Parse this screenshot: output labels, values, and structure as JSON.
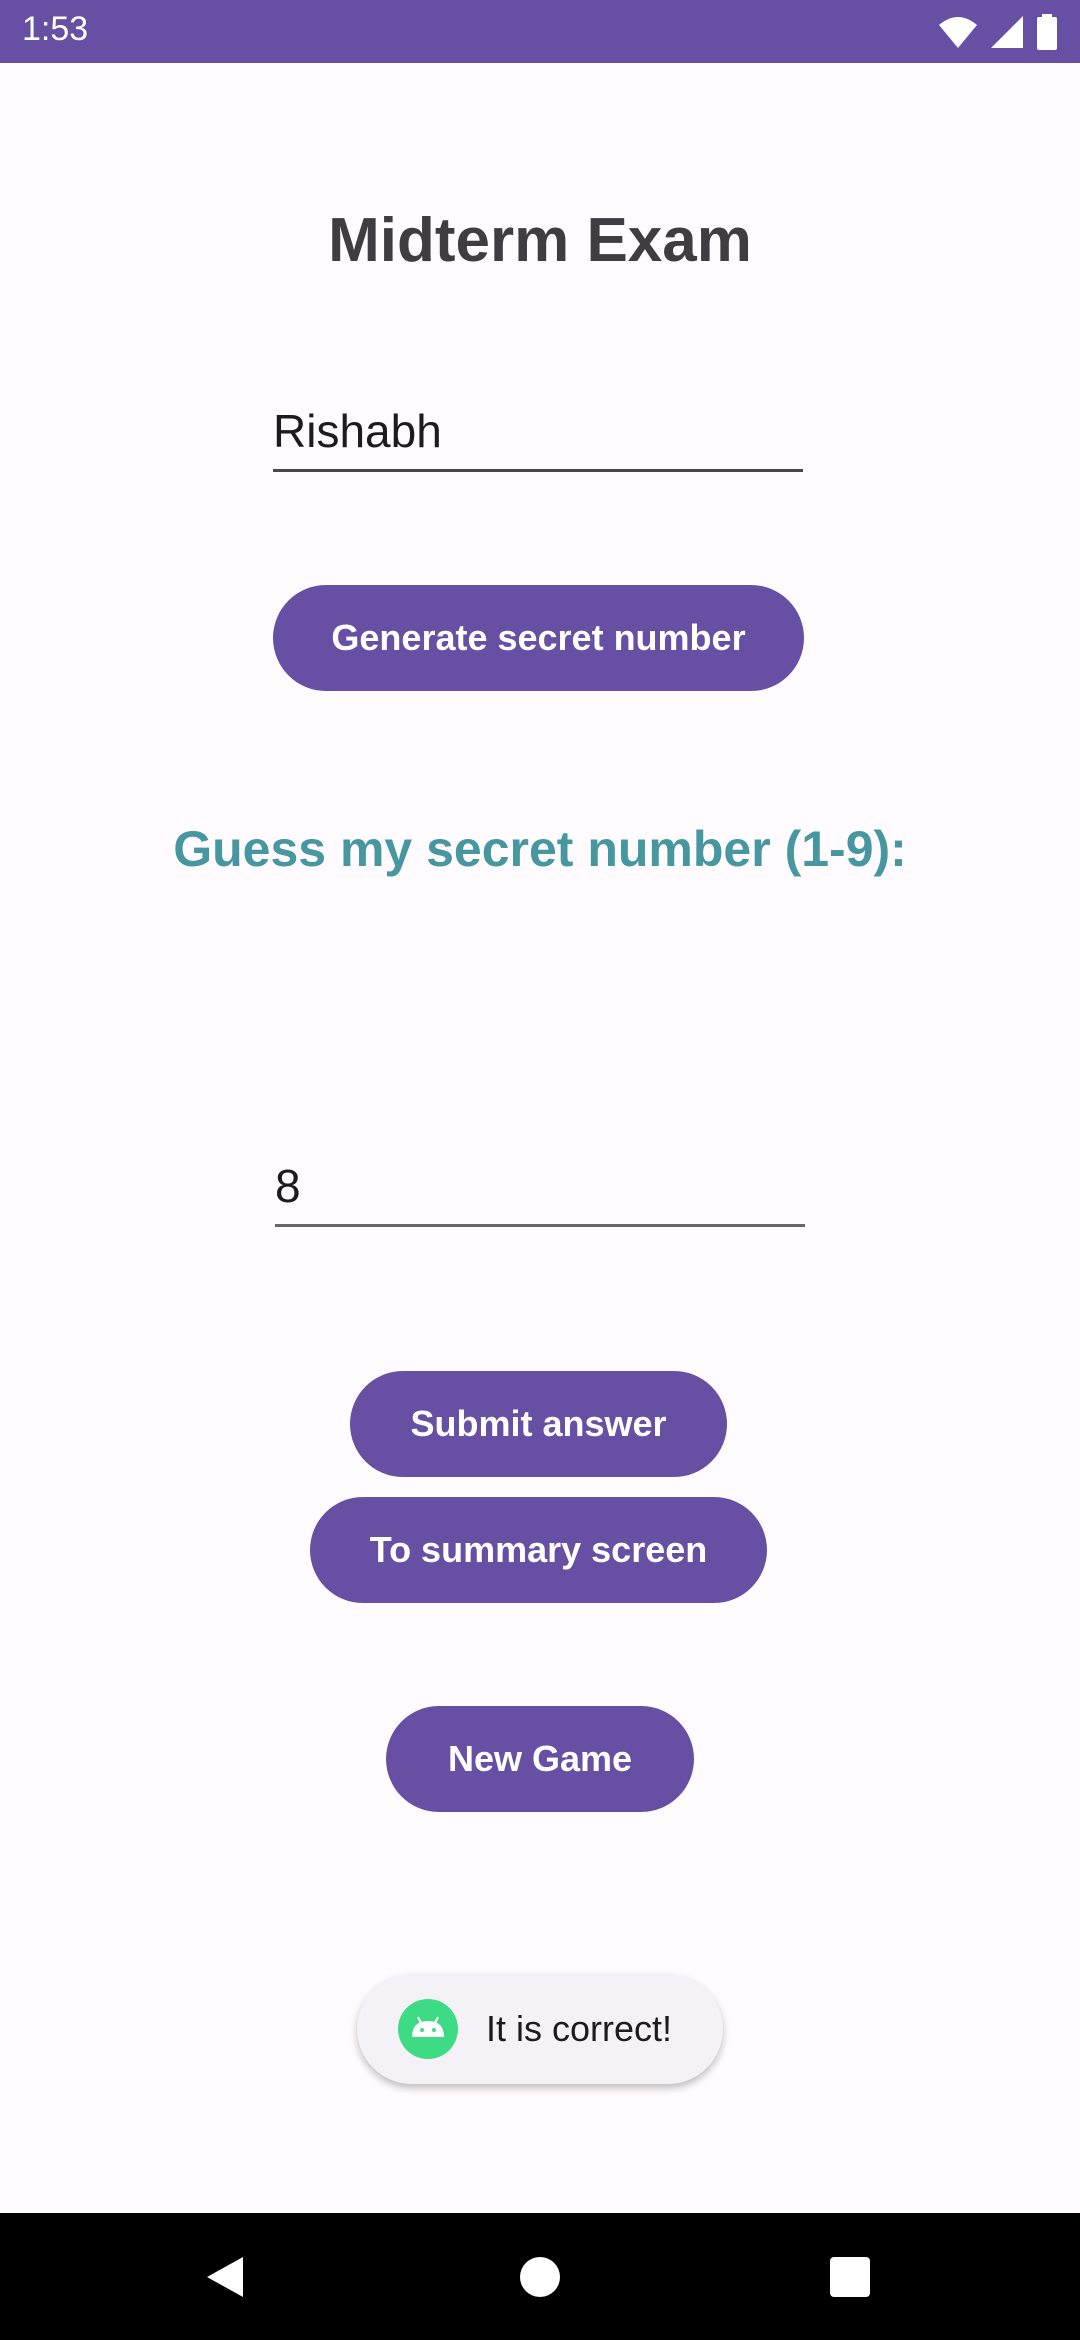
{
  "status_bar": {
    "time": "1:53",
    "icons": [
      "wifi-icon",
      "cellular-signal-icon",
      "battery-icon"
    ],
    "color": "#6750a4"
  },
  "title": "Midterm Exam",
  "name_field": {
    "value": "Rishabh"
  },
  "generate_button": {
    "label": "Generate secret number"
  },
  "prompt": "Guess my secret number (1-9):",
  "guess_field": {
    "value": "8"
  },
  "submit_button": {
    "label": "Submit answer"
  },
  "summary_button": {
    "label": "To summary screen"
  },
  "new_game_button": {
    "label": "New Game"
  },
  "toast": {
    "icon": "android-icon",
    "message": "It is correct!"
  },
  "nav_bar": {
    "icons": [
      "back-icon",
      "home-icon",
      "recents-icon"
    ]
  },
  "colors": {
    "accent": "#6750a4",
    "prompt": "#4797a0",
    "background": "#fffbfe"
  }
}
